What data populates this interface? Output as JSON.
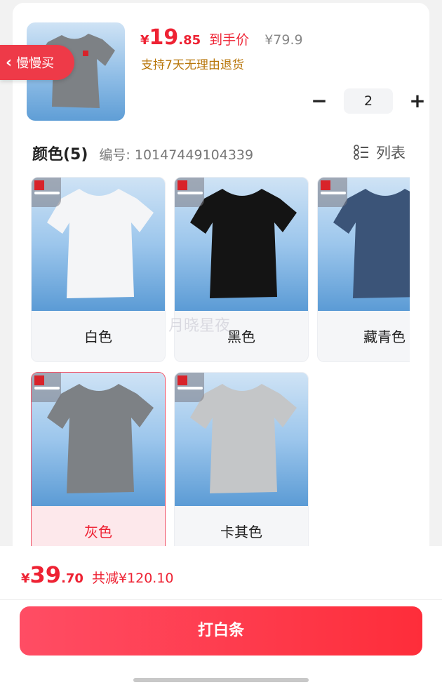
{
  "header": {
    "back_label": "慢慢买",
    "price": {
      "currency": "¥",
      "integer": "19",
      "decimal": ".85",
      "tag": "到手价"
    },
    "original_price": "¥79.9",
    "promise": "支持7天无理由退货"
  },
  "quantity": {
    "minus": "−",
    "value": "2",
    "plus": "+"
  },
  "colors": {
    "title": "颜色(5)",
    "sku": "编号: 10147449104339",
    "view_label": "列表",
    "items": [
      {
        "label": "白色",
        "shirt_color": "#f4f5f7",
        "selected": false
      },
      {
        "label": "黑色",
        "shirt_color": "#141414",
        "selected": false
      },
      {
        "label": "藏青色",
        "shirt_color": "#3b5478",
        "selected": false
      },
      {
        "label": "灰色",
        "shirt_color": "#7d8185",
        "selected": true
      },
      {
        "label": "卡其色",
        "shirt_color": "#c4c6c8",
        "selected": false
      }
    ]
  },
  "watermark": "月晓星夜",
  "footer": {
    "total": {
      "currency": "¥",
      "integer": "39",
      "decimal": ".70"
    },
    "saved": "共减¥120.10",
    "cta": "打白条"
  },
  "theme": {
    "accent": "#ee2233",
    "promise": "#b8760a"
  }
}
